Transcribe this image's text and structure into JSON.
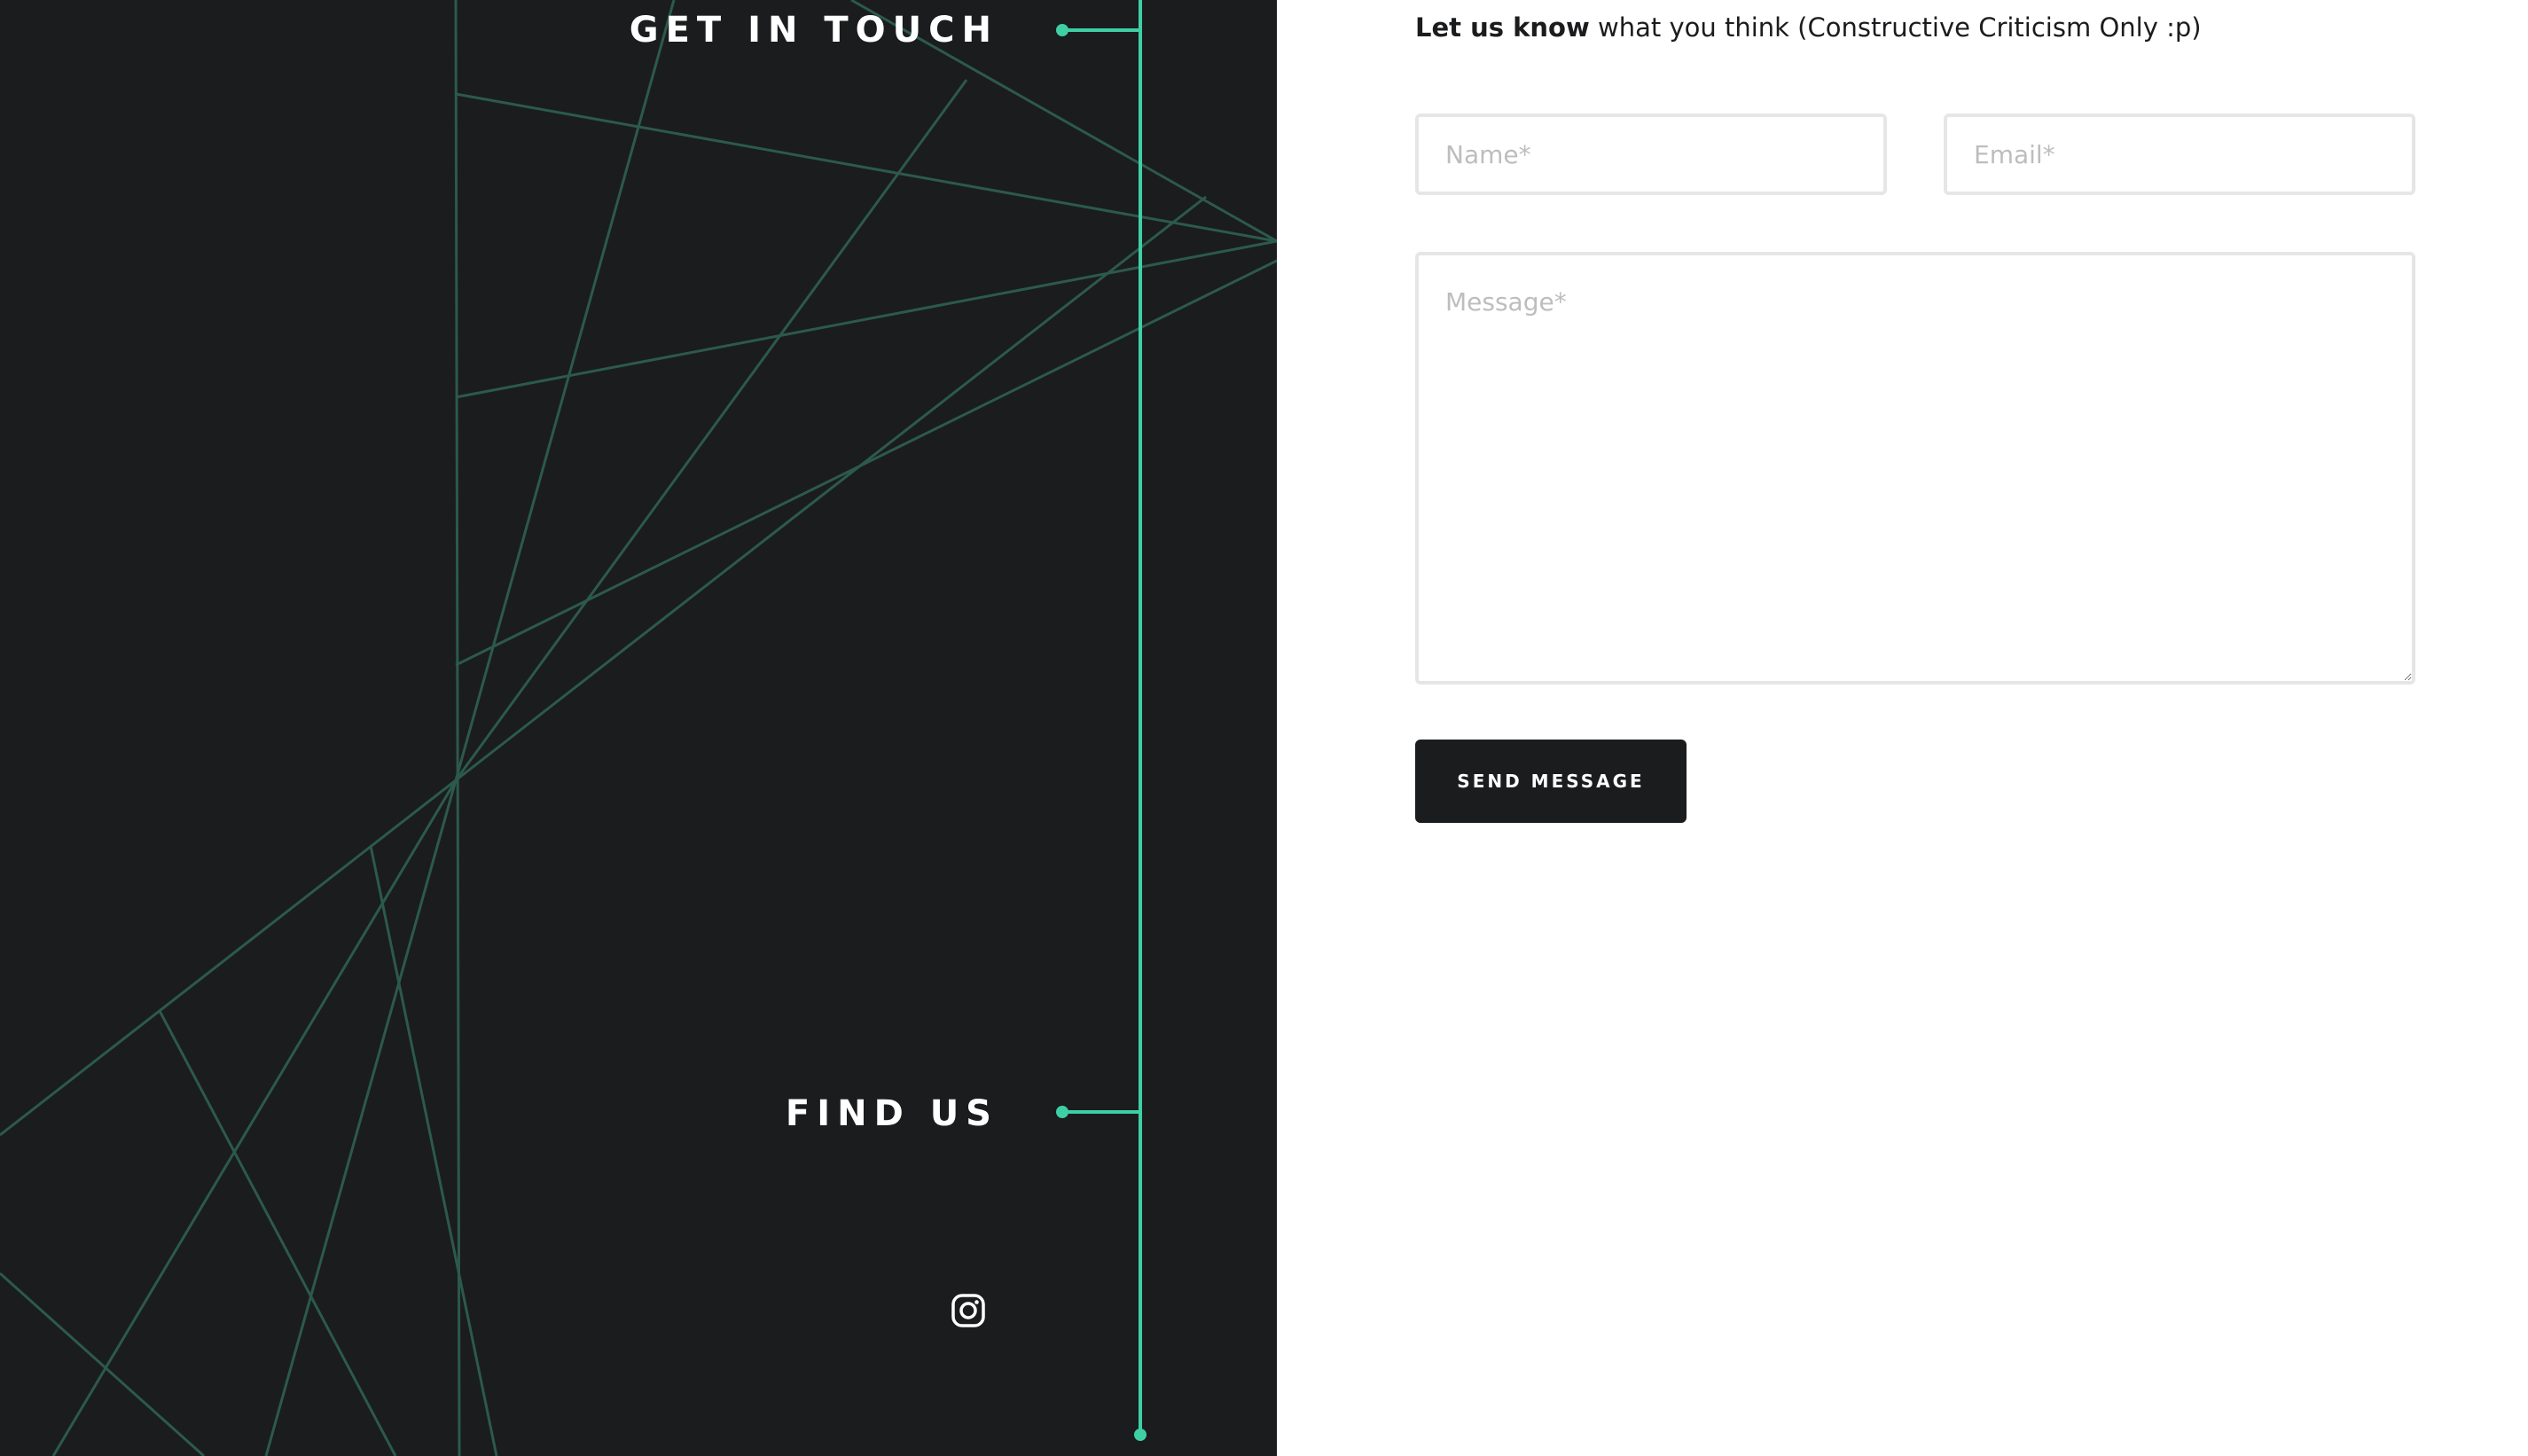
{
  "sections": {
    "get_in_touch": "GET IN TOUCH",
    "find_us": "FIND US"
  },
  "social": {
    "instagram_icon": "instagram-icon"
  },
  "form": {
    "intro_bold": "Let us know",
    "intro_rest": " what you think (Constructive Criticism Only :p)",
    "name_placeholder": "Name*",
    "email_placeholder": "Email*",
    "message_placeholder": "Message*",
    "submit_label": "SEND MESSAGE"
  },
  "colors": {
    "panel_background": "#1b1c1e",
    "accent": "#3ecfa5",
    "decorative_lines": "#2c5a4a",
    "button_background": "#1b1c1e",
    "input_border": "#e6e6e6"
  }
}
